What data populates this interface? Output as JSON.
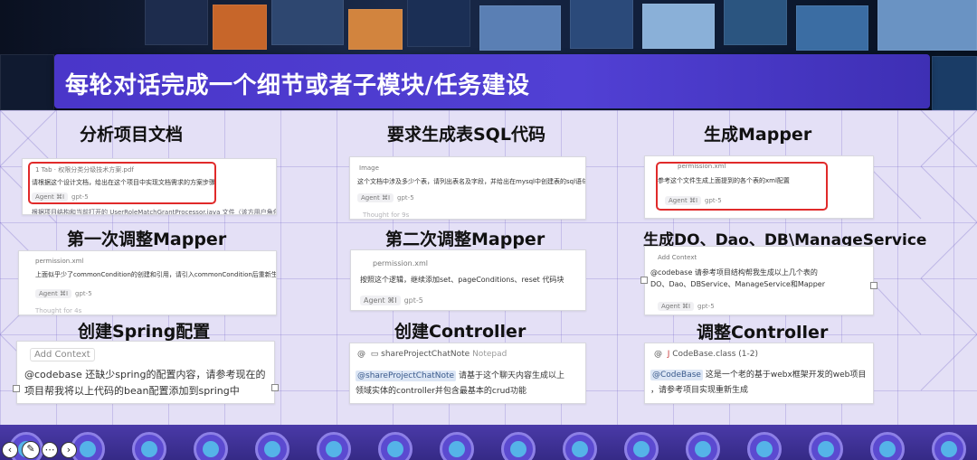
{
  "slide": {
    "title": "每轮对话完成一个细节或者子模块/任务建设"
  },
  "steps": [
    {
      "heading": "分析项目文档",
      "card": {
        "meta": "1 Tab  ·  权限分类分级技术方案.pdf",
        "body": "请根据这个设计文档，给出在这个项目中实现文档需求的方案步骤",
        "agent_label": "Agent",
        "agent_shortcut": "⌘I",
        "model": "gpt-5",
        "footer": "根据项目结构和当前打开的 UserRoleMatchGrantProcessor.java 文件（该方用户角色权限授权处理"
      }
    },
    {
      "heading": "要求生成表SQL代码",
      "card": {
        "meta": "Image",
        "body": "这个文档中涉及多少个表，请列出表名及字段，并给出在mysql中创建表的sql语句",
        "agent_label": "Agent",
        "agent_shortcut": "⌘I",
        "model": "gpt-5",
        "footer": "Thought for 9s"
      }
    },
    {
      "heading": "生成Mapper",
      "card": {
        "meta": "permission.xml",
        "body": "参考这个文件生成上面提到的各个表的xml配置",
        "agent_label": "Agent",
        "agent_shortcut": "⌘I",
        "model": "gpt-5"
      }
    },
    {
      "heading": "第一次调整Mapper",
      "card": {
        "meta": "permission.xml",
        "body": "上面似乎少了commonCondition的创建和引用，请引入commonCondition后重新生成",
        "agent_label": "Agent",
        "agent_shortcut": "⌘I",
        "model": "gpt-5",
        "footer": "Thought for 4s"
      }
    },
    {
      "heading": "第二次调整Mapper",
      "card": {
        "meta": "permission.xml",
        "body": "按照这个逻辑，继续添加set、pageConditions、reset 代码块",
        "agent_label": "Agent",
        "agent_shortcut": "⌘I",
        "model": "gpt-5"
      }
    },
    {
      "heading": "生成DO、Dao、DB\\ManageService",
      "card": {
        "meta": "Add Context",
        "body_line1": "@codebase 请参考项目结构帮我生成以上几个表的",
        "body_line2": "DO、Dao、DBService、ManageService和Mapper",
        "agent_label": "Agent",
        "agent_shortcut": "⌘I",
        "model": "gpt-5"
      }
    },
    {
      "heading": "创建Spring配置",
      "card": {
        "meta": "Add Context",
        "body_line1": "@codebase 还缺少spring的配置内容，请参考现在的",
        "body_line2": "项目帮我将以上代码的bean配置添加到spring中"
      }
    },
    {
      "heading": "创建Controller",
      "card": {
        "meta_name": "shareProjectChatNote",
        "meta_suffix": "Notepad",
        "mention": "@shareProjectChatNote",
        "body_line1": "请基于这个聊天内容生成以上",
        "body_line2": "领域实体的controller并包含最基本的crud功能"
      }
    },
    {
      "heading": "调整Controller",
      "card": {
        "meta": "CodeBase.class (1-2)",
        "mention": "@CodeBase",
        "body_line1": "这是一个老的基于webx框架开发的web项目",
        "body_line2": "，请参考项目实现重新生成"
      }
    }
  ],
  "colors": {
    "title_bar": "#4f3ecf",
    "highlight_box": "#e02a2a",
    "grid_bg": "#e4e0f6",
    "bottom_strip": "#3e2f96"
  }
}
